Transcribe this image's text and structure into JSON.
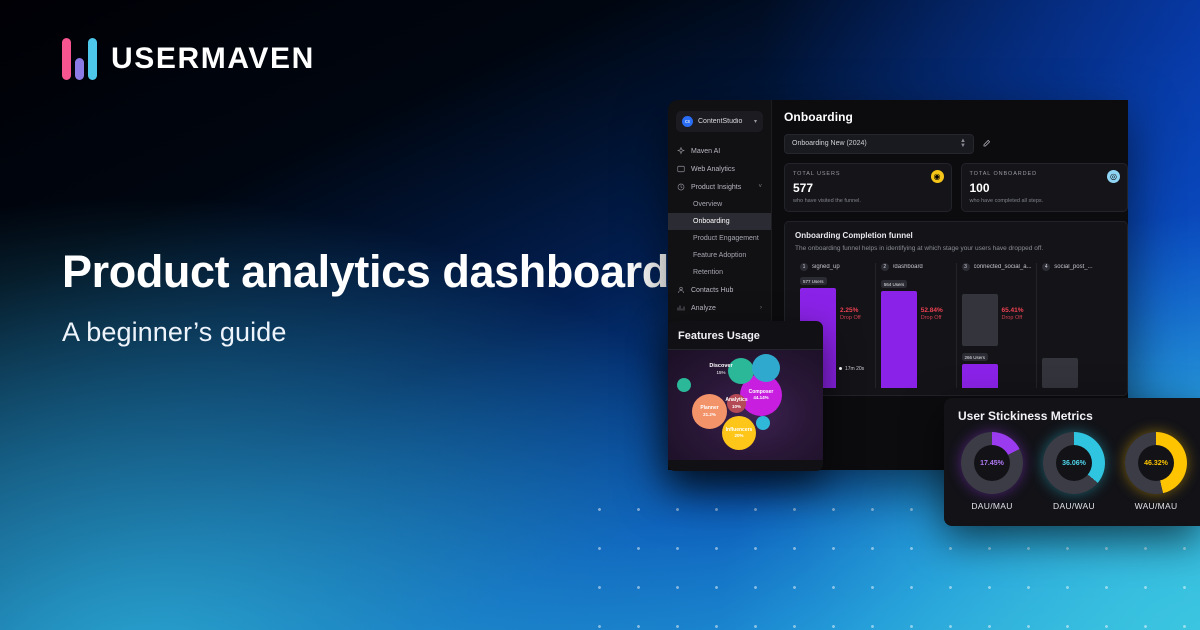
{
  "brand": {
    "name": "USERMAVEN",
    "logo_colors": [
      "#f7558f",
      "#8c7ae6",
      "#4ec8ea"
    ]
  },
  "headline": {
    "title": "Product analytics dashboard",
    "subtitle": "A beginner’s guide"
  },
  "dashboard": {
    "workspace": {
      "name": "ContentStudio",
      "chevron": "▾"
    },
    "sidebar": [
      {
        "label": "Maven AI",
        "icon": "sparkle-icon",
        "active": false,
        "sub": false
      },
      {
        "label": "Web Analytics",
        "icon": "window-icon",
        "active": false,
        "sub": false
      },
      {
        "label": "Product Insights",
        "icon": "clock-icon",
        "active": false,
        "sub": false,
        "chevron": "˅"
      },
      {
        "label": "Overview",
        "icon": "",
        "active": false,
        "sub": true
      },
      {
        "label": "Onboarding",
        "icon": "",
        "active": true,
        "sub": true
      },
      {
        "label": "Product Engagement",
        "icon": "",
        "active": false,
        "sub": true
      },
      {
        "label": "Feature Adoption",
        "icon": "",
        "active": false,
        "sub": true
      },
      {
        "label": "Retention",
        "icon": "",
        "active": false,
        "sub": true
      },
      {
        "label": "Contacts Hub",
        "icon": "person-icon",
        "active": false,
        "sub": false
      },
      {
        "label": "Analyze",
        "icon": "chart-icon",
        "active": false,
        "sub": false,
        "chevron": "›"
      }
    ],
    "page_title": "Onboarding",
    "funnel_select": {
      "value": "Onboarding New (2024)",
      "edit_icon": "edit-icon"
    },
    "cards": [
      {
        "label": "TOTAL USERS",
        "value": "577",
        "sub": "who have visited the funnel.",
        "icon": "gold-coin-icon"
      },
      {
        "label": "TOTAL ONBOARDED",
        "value": "100",
        "sub": "who have completed all steps.",
        "icon": "blue-globe-icon"
      }
    ],
    "funnel_panel": {
      "title": "Onboarding Completion funnel",
      "description": "The onboarding funnel helps in identifying at which stage your users have dropped off.",
      "time_label": "17m 20s"
    },
    "chart_data": {
      "type": "bar",
      "title": "Onboarding Completion funnel",
      "categories": [
        "signed_up",
        "/dashboard",
        "connected_social_a...",
        "social_post_..."
      ],
      "values": [
        577,
        564,
        266,
        92
      ],
      "value_labels": [
        "577 Users",
        "564 Users",
        "266 Users",
        ""
      ],
      "drop_offs": [
        "2.25%",
        "52.84%",
        "65.41%",
        ""
      ],
      "drop_off_label": "Drop Off",
      "ylabel": "Users",
      "ylim": [
        0,
        620
      ]
    }
  },
  "features_usage": {
    "title": "Features Usage",
    "chart_data": {
      "type": "bubble",
      "title": "Features Usage",
      "categories": [
        "Composer",
        "Planner",
        "Influencers",
        "Discover",
        "Analytics"
      ],
      "values": [
        44.14,
        21.2,
        20,
        15,
        10
      ],
      "labels": [
        "44.14%",
        "21.2%",
        "20%",
        "15%",
        "10%"
      ],
      "colors": [
        "#c81ee0",
        "#f3936a",
        "#ffc61a",
        "#2bb898",
        "#b44a55"
      ]
    }
  },
  "stickiness": {
    "title": "User Stickiness Metrics",
    "chart_data": {
      "type": "pie",
      "title": "User Stickiness Metrics",
      "categories": [
        "DAU/MAU",
        "DAU/WAU",
        "WAU/MAU"
      ],
      "values": [
        17.45,
        36.06,
        46.32
      ],
      "labels": [
        "17.45%",
        "36.06%",
        "46.32%"
      ],
      "colors": [
        "#9b3bf0",
        "#2fc5e0",
        "#ffc400"
      ]
    }
  }
}
